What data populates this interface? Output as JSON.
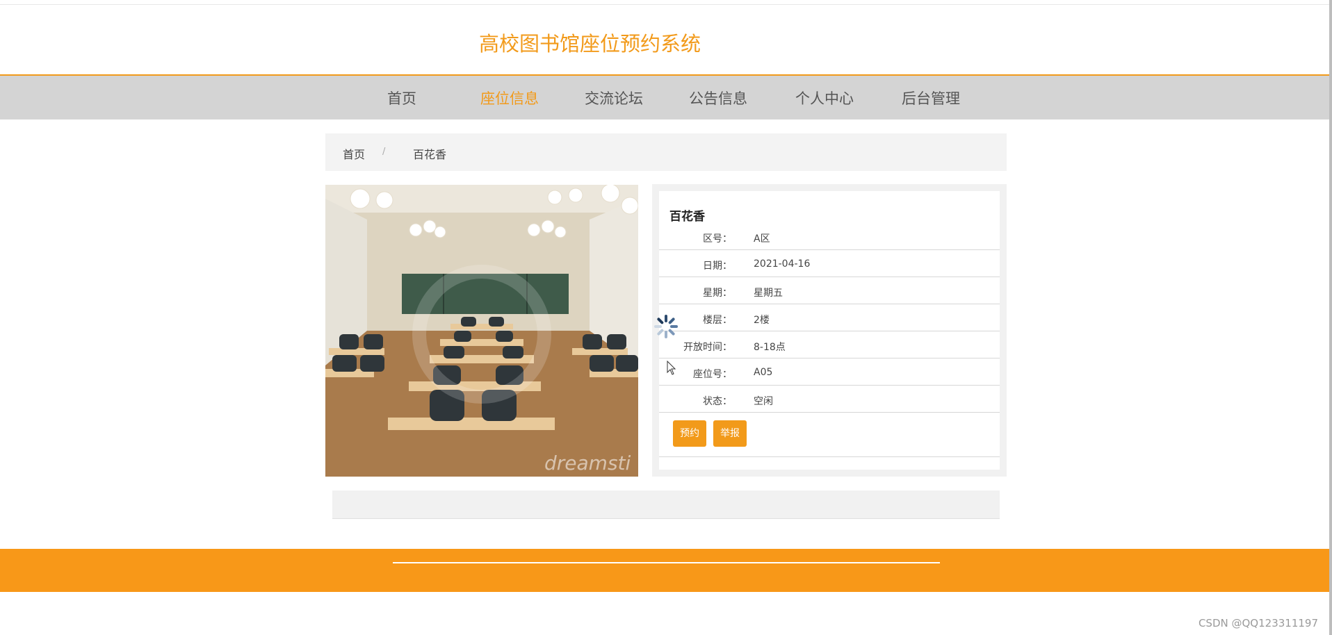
{
  "site": {
    "title": "高校图书馆座位预约系统"
  },
  "nav": {
    "items": [
      {
        "label": "首页"
      },
      {
        "label": "座位信息"
      },
      {
        "label": "交流论坛"
      },
      {
        "label": "公告信息"
      },
      {
        "label": "个人中心"
      },
      {
        "label": "后台管理"
      }
    ],
    "active_color": "#f29a1a"
  },
  "breadcrumb": {
    "home": "首页",
    "separator": "/",
    "current": "百花香"
  },
  "detail": {
    "title": "百花香",
    "rows": [
      {
        "label": "区号：",
        "value": "A区"
      },
      {
        "label": "日期：",
        "value": "2021-04-16"
      },
      {
        "label": "星期：",
        "value": "星期五"
      },
      {
        "label": "楼层：",
        "value": "2楼"
      },
      {
        "label": "开放时间：",
        "value": "8-18点"
      },
      {
        "label": "座位号：",
        "value": "A05"
      },
      {
        "label": "状态：",
        "value": "空闲"
      }
    ],
    "buttons": {
      "reserve": "预约",
      "report": "举报"
    }
  },
  "photo": {
    "watermark_text": "dreamsti"
  },
  "watermark": "CSDN @QQ123311197",
  "colors": {
    "accent": "#f29a1a",
    "footer": "#f89818",
    "nav_bg": "#d4d4d4"
  }
}
